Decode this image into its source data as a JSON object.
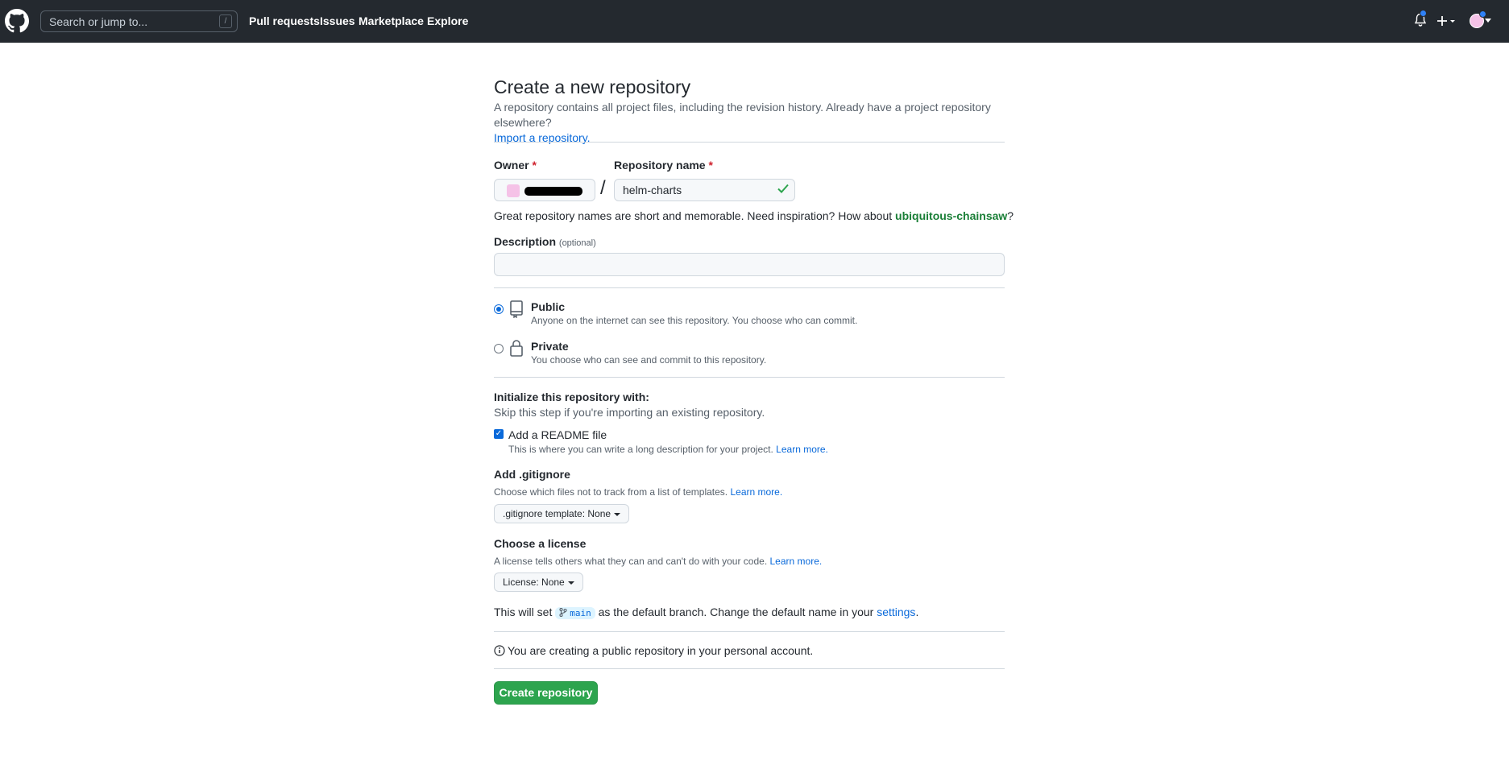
{
  "header": {
    "search_placeholder": "Search or jump to...",
    "search_shortcut": "/",
    "nav": [
      "Pull requests",
      "Issues",
      "Marketplace",
      "Explore"
    ]
  },
  "page": {
    "title": "Create a new repository",
    "subtitle": "A repository contains all project files, including the revision history. Already have a project repository elsewhere?",
    "import_link": "Import a repository."
  },
  "form": {
    "owner_label": "Owner",
    "repo_label": "Repository name",
    "required_mark": "*",
    "slash": "/",
    "repo_value": "helm-charts",
    "hint_prefix": "Great repository names are short and memorable. Need inspiration? How about ",
    "hint_suggestion": "ubiquitous-chainsaw",
    "hint_suffix": "?",
    "description_label": "Description",
    "description_optional": "(optional)",
    "description_value": ""
  },
  "visibility": {
    "public_title": "Public",
    "public_sub": "Anyone on the internet can see this repository. You choose who can commit.",
    "private_title": "Private",
    "private_sub": "You choose who can see and commit to this repository.",
    "selected": "Public"
  },
  "init": {
    "title": "Initialize this repository with:",
    "sub": "Skip this step if you're importing an existing repository.",
    "readme_label": "Add a README file",
    "readme_sub": "This is where you can write a long description for your project.",
    "readme_checked": true,
    "learn_more": "Learn more.",
    "gitignore_title": "Add .gitignore",
    "gitignore_sub": "Choose which files not to track from a list of templates.",
    "gitignore_dropdown": ".gitignore template: None",
    "license_title": "Choose a license",
    "license_sub": "A license tells others what they can and can't do with your code.",
    "license_dropdown": "License: None",
    "branch_prefix": "This will set ",
    "branch_name": "main",
    "branch_suffix": " as the default branch. Change the default name in your ",
    "settings_link": "settings",
    "branch_end": "."
  },
  "footer": {
    "info": "You are creating a public repository in your personal account.",
    "create_button": "Create repository"
  },
  "colors": {
    "header_bg": "#24292f",
    "link": "#0969da",
    "green_button": "#2da44e",
    "suggestion_green": "#1a7f37"
  }
}
